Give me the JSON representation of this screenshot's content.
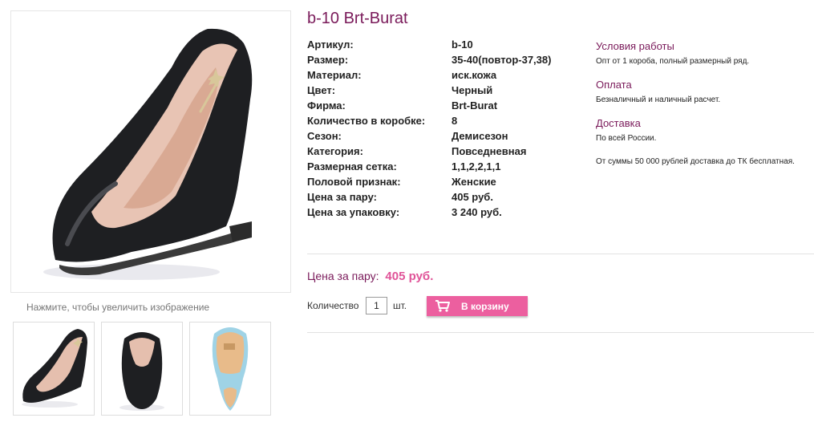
{
  "product": {
    "title": "b-10 Brt-Burat",
    "zoom_hint": "Нажмите, чтобы увеличить изображение"
  },
  "specs": [
    {
      "label": "Артикул:",
      "value": "b-10"
    },
    {
      "label": "Размер:",
      "value": "35-40(повтор-37,38)"
    },
    {
      "label": "Материал:",
      "value": "иск.кожа"
    },
    {
      "label": "Цвет:",
      "value": "Черный"
    },
    {
      "label": "Фирма:",
      "value": "Brt-Burat"
    },
    {
      "label": "Количество в коробке:",
      "value": "8"
    },
    {
      "label": "Сезон:",
      "value": "Демисезон"
    },
    {
      "label": "Категория:",
      "value": "Повседневная"
    },
    {
      "label": "Размерная сетка:",
      "value": "1,1,2,2,1,1"
    },
    {
      "label": "Половой признак:",
      "value": "Женские"
    },
    {
      "label": "Цена за пару:",
      "value": "405 руб."
    },
    {
      "label": "Цена за упаковку:",
      "value": "3 240 руб."
    }
  ],
  "info": {
    "terms_heading": "Условия работы",
    "terms_text": "Опт от 1 короба, полный размерный ряд.",
    "payment_heading": "Оплата",
    "payment_text": "Безналичный и наличный расчет.",
    "delivery_heading": "Доставка",
    "delivery_text": "По всей России.",
    "delivery_note": "От суммы 50 000 рублей доставка до ТК бесплатная."
  },
  "purchase": {
    "price_label": "Цена за пару:",
    "price_value": "405 руб.",
    "quantity_label": "Количество",
    "quantity_value": "1",
    "unit": "шт.",
    "cart_button": "В корзину"
  },
  "colors": {
    "accent": "#7a1a5a",
    "price": "#e05398",
    "button": "#ec5f9f"
  }
}
